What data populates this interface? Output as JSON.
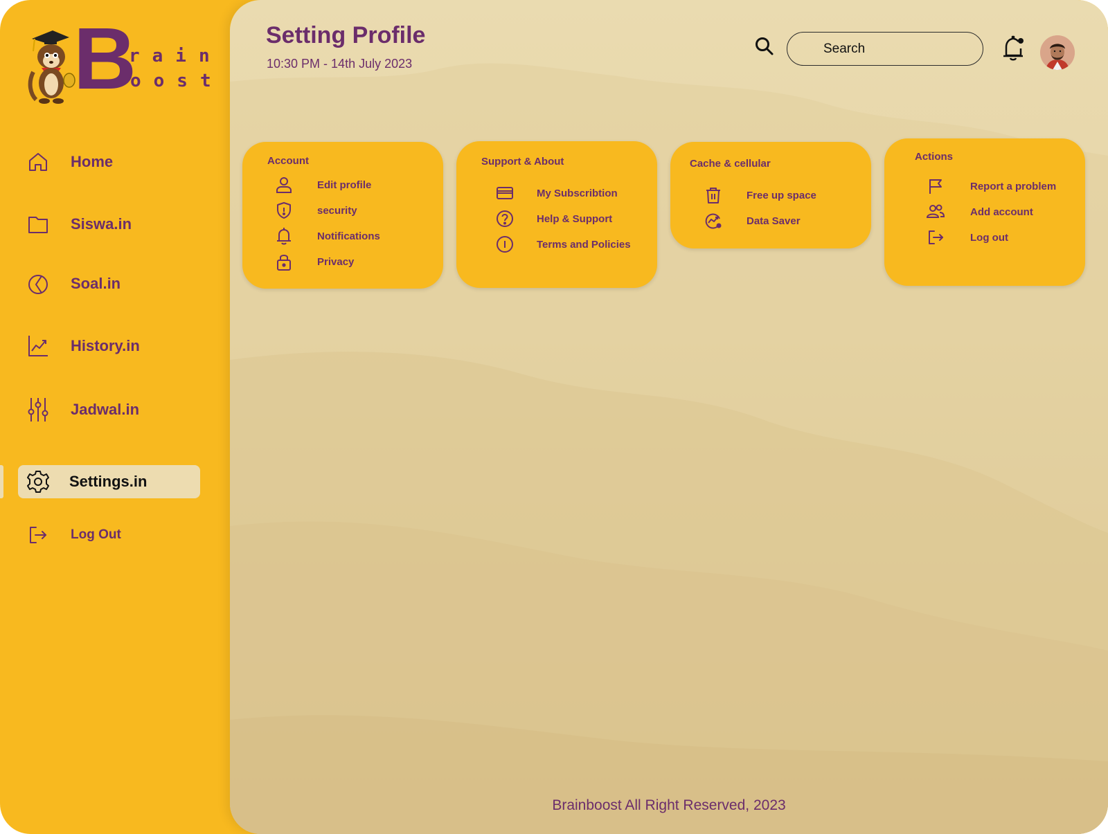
{
  "brand": {
    "letter": "B",
    "row1": "rain",
    "row2": "oost"
  },
  "sidebar": {
    "items": [
      {
        "label": "Home",
        "icon": "home-icon"
      },
      {
        "label": "Siswa.in",
        "icon": "folder-icon"
      },
      {
        "label": "Soal.in",
        "icon": "pie-chart-icon"
      },
      {
        "label": "History.in",
        "icon": "chart-line-icon"
      },
      {
        "label": "Jadwal.in",
        "icon": "sliders-icon"
      },
      {
        "label": "Settings.in",
        "icon": "gear-icon",
        "active": true
      },
      {
        "label": "Log Out",
        "icon": "logout-icon"
      }
    ]
  },
  "header": {
    "title": "Setting Profile",
    "datetime": "10:30 PM - 14th July 2023",
    "search_placeholder": "Search"
  },
  "cards": {
    "account": {
      "title": "Account",
      "items": [
        {
          "label": "Edit profile",
          "icon": "user-icon"
        },
        {
          "label": "security",
          "icon": "shield-icon"
        },
        {
          "label": "Notifications",
          "icon": "bell-icon"
        },
        {
          "label": "Privacy",
          "icon": "lock-icon"
        }
      ]
    },
    "support": {
      "title": "Support & About",
      "items": [
        {
          "label": "My Subscribtion",
          "icon": "credit-card-icon"
        },
        {
          "label": "Help & Support",
          "icon": "help-circle-icon"
        },
        {
          "label": "Terms and Policies",
          "icon": "info-icon"
        }
      ]
    },
    "cache": {
      "title": "Cache & cellular",
      "items": [
        {
          "label": "Free up space",
          "icon": "trash-icon"
        },
        {
          "label": "Data Saver",
          "icon": "data-saver-icon"
        }
      ]
    },
    "actions": {
      "title": "Actions",
      "items": [
        {
          "label": "Report a problem",
          "icon": "flag-icon"
        },
        {
          "label": "Add account",
          "icon": "users-icon"
        },
        {
          "label": "Log out",
          "icon": "logout-icon"
        }
      ]
    }
  },
  "footer": {
    "text": "Brainboost All Right Reserved, 2023"
  },
  "colors": {
    "sidebar_bg": "#f8b91f",
    "accent_purple": "#6b2d6b",
    "main_bg": "#e8d7aa",
    "active_item_bg": "#eddcb0"
  }
}
